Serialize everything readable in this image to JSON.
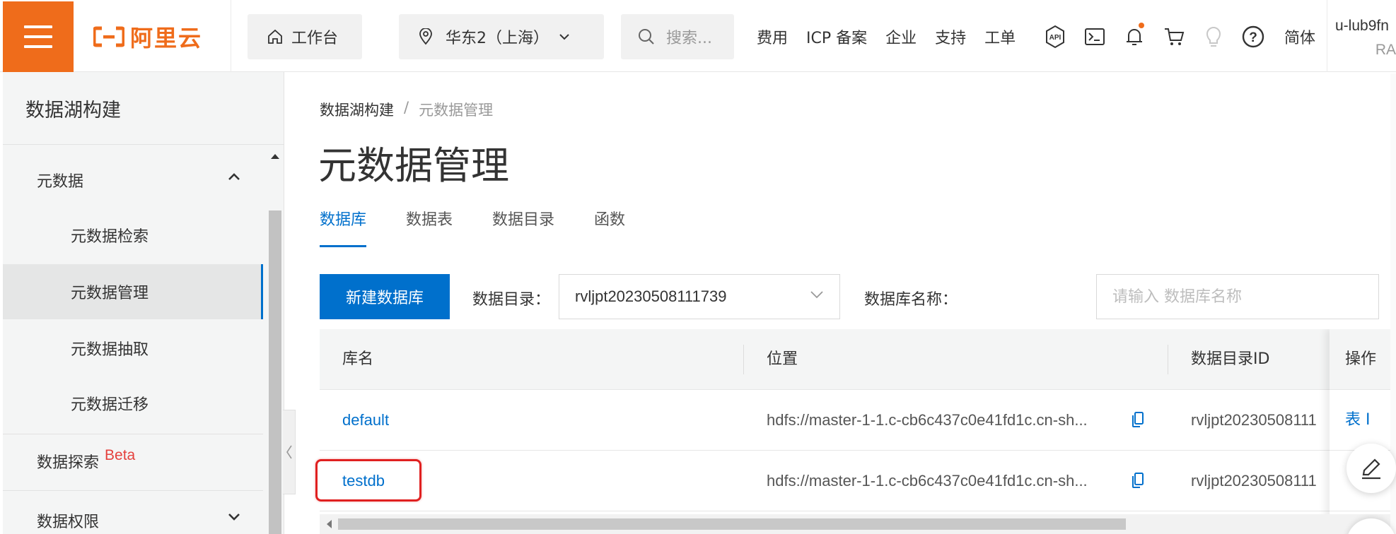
{
  "topbar": {
    "logo_text": "阿里云",
    "workbench": "工作台",
    "region": "华东2（上海）",
    "search_placeholder": "搜索...",
    "links": [
      "费用",
      "ICP 备案",
      "企业",
      "支持",
      "工单"
    ],
    "icons": [
      "api-icon",
      "terminal-icon",
      "bell-icon",
      "cart-icon",
      "lightbulb-icon",
      "help-icon"
    ],
    "language": "简体",
    "user_line1": "u-lub9fn",
    "user_line2": "RA",
    "accent": "#ef6c1b"
  },
  "sidebar": {
    "title": "数据湖构建",
    "group_metadata": "元数据",
    "items": [
      "元数据检索",
      "元数据管理",
      "元数据抽取",
      "元数据迁移"
    ],
    "active_item": "元数据管理",
    "explore": "数据探索",
    "explore_badge": "Beta",
    "permissions": "数据权限"
  },
  "main": {
    "breadcrumb_root": "数据湖构建",
    "breadcrumb_sep": "/",
    "breadcrumb_current": "元数据管理",
    "title": "元数据管理",
    "tabs": [
      "数据库",
      "数据表",
      "数据目录",
      "函数"
    ],
    "active_tab": "数据库",
    "new_db_button": "新建数据库",
    "catalog_label": "数据目录：",
    "catalog_value": "rvljpt20230508111739",
    "dbname_label": "数据库名称：",
    "dbname_placeholder": "请输入 数据库名称",
    "columns": [
      "库名",
      "位置",
      "数据目录ID",
      "操作"
    ],
    "rows": [
      {
        "name": "default",
        "location": "hdfs://master-1-1.c-cb6c437c0e41fd1c.cn-sh...",
        "catalog_id": "rvljpt20230508111",
        "op": "表 I"
      },
      {
        "name": "testdb",
        "location": "hdfs://master-1-1.c-cb6c437c0e41fd1c.cn-sh...",
        "catalog_id": "rvljpt20230508111",
        "op": ""
      }
    ],
    "link_color": "#0070cc"
  }
}
